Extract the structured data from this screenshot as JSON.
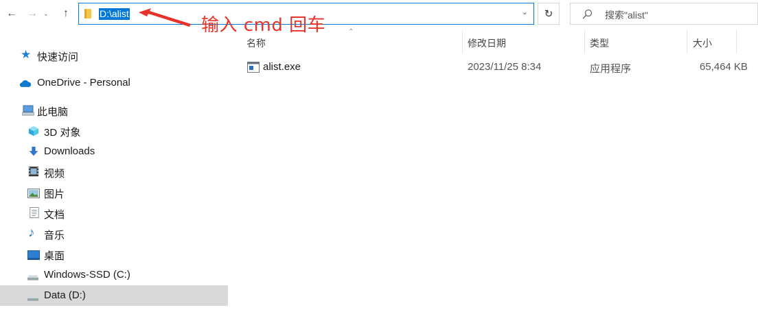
{
  "address": {
    "path": "D:\\alist"
  },
  "search": {
    "placeholder": "搜索\"alist\""
  },
  "annotation": {
    "text": "输入 cmd 回车",
    "color": "#e8322a"
  },
  "columns": {
    "name": "名称",
    "modified": "修改日期",
    "type": "类型",
    "size": "大小"
  },
  "sidebar": {
    "items": [
      {
        "label": "快速访问",
        "icon": "star-icon"
      },
      {
        "label": "OneDrive - Personal",
        "icon": "cloud-icon"
      },
      {
        "label": "此电脑",
        "icon": "computer-icon"
      },
      {
        "label": "3D 对象",
        "icon": "cube-icon"
      },
      {
        "label": "Downloads",
        "icon": "download-arrow-icon"
      },
      {
        "label": "视频",
        "icon": "video-icon"
      },
      {
        "label": "图片",
        "icon": "picture-icon"
      },
      {
        "label": "文档",
        "icon": "document-icon"
      },
      {
        "label": "音乐",
        "icon": "music-note-icon"
      },
      {
        "label": "桌面",
        "icon": "desktop-icon"
      },
      {
        "label": "Windows-SSD (C:)",
        "icon": "drive-icon"
      },
      {
        "label": "Data (D:)",
        "icon": "drive-icon",
        "selected": true
      }
    ]
  },
  "files": [
    {
      "name": "alist.exe",
      "modified": "2023/11/25 8:34",
      "type": "应用程序",
      "size": "65,464 KB"
    }
  ],
  "colors": {
    "accent": "#0078d7",
    "selection": "#d9d9d9",
    "annotation": "#e8322a"
  }
}
